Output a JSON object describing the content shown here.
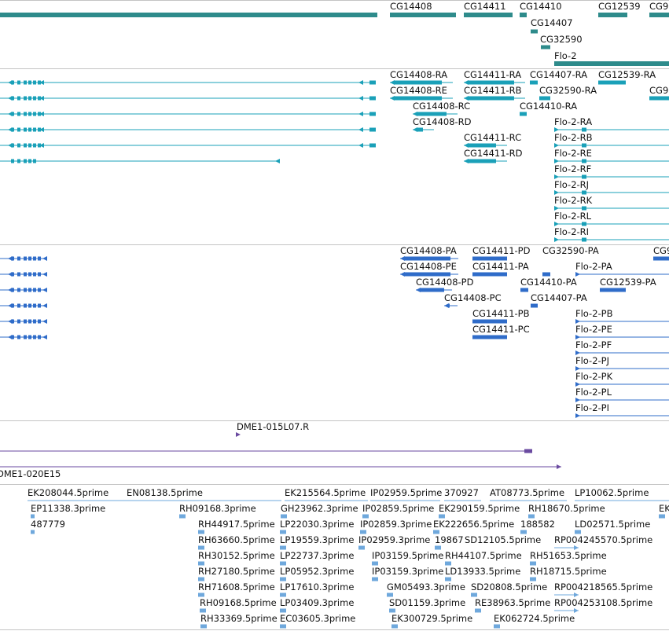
{
  "colors": {
    "gene": "#2e8b8b",
    "transcript": "#1aa0b8",
    "protein": "#2f6cc9",
    "clone": "#6a4aa0",
    "est": "#6fa8dc",
    "separator": "#c4c4c4"
  },
  "tracks": {
    "genes": {
      "labels": [
        "CG14408",
        "CG14411",
        "CG14410",
        "CG12539",
        "CG9",
        "CG14407",
        "CG32590",
        "Flo-2"
      ]
    },
    "transcripts": {
      "labels": [
        "CG14408-RA",
        "CG14411-RA",
        "CG14407-RA",
        "CG12539-RA",
        "CG14408-RE",
        "CG14411-RB",
        "CG32590-RA",
        "CG9",
        "CG14408-RC",
        "CG14410-RA",
        "CG14408-RD",
        "Flo-2-RA",
        "CG14411-RC",
        "Flo-2-RB",
        "CG14411-RD",
        "Flo-2-RE",
        "Flo-2-RF",
        "Flo-2-RJ",
        "Flo-2-RK",
        "Flo-2-RL",
        "Flo-2-RI"
      ]
    },
    "proteins": {
      "labels": [
        "CG14408-PA",
        "CG14411-PD",
        "CG32590-PA",
        "CG9",
        "CG14408-PE",
        "CG14411-PA",
        "Flo-2-PA",
        "CG14408-PD",
        "CG14410-PA",
        "CG12539-PA",
        "CG14408-PC",
        "CG14407-PA",
        "CG14411-PB",
        "Flo-2-PB",
        "CG14411-PC",
        "Flo-2-PE",
        "Flo-2-PF",
        "Flo-2-PJ",
        "Flo-2-PK",
        "Flo-2-PL",
        "Flo-2-PI"
      ]
    },
    "clones": {
      "labels": [
        "DME1-015L07.R",
        "DME1-020E15"
      ]
    },
    "ests": {
      "labels": [
        "EK208044.5prime",
        "EN08138.5prime",
        "EK215564.5prime",
        "IP02959.5prime",
        "370927",
        "AT08773.5prime",
        "LP10062.5prime",
        "EK",
        "EP11338.3prime",
        "RH09168.3prime",
        "GH23962.3prime",
        "IP02859.5prime",
        "EK290159.5prime",
        "RH18670.5prime",
        "487779",
        "RH44917.5prime",
        "LP22030.3prime",
        "IP02859.3prime",
        "EK222656.5prime",
        "188582",
        "LD02571.5prime",
        "RH63660.5prime",
        "LP19559.3prime",
        "IP02959.3prime",
        "19867",
        "SD12105.5prime",
        "RP004245570.5prime",
        "RH30152.5prime",
        "LP22737.3prime",
        "IP03159.5prime",
        "RH44107.5prime",
        "RH51653.5prime",
        "RH27180.5prime",
        "LP05952.3prime",
        "IP03159.3prime",
        "LD13933.5prime",
        "RH18715.5prime",
        "RH71608.5prime",
        "LP17610.3prime",
        "GM05493.3prime",
        "SD20808.5prime",
        "RP004218565.5prime",
        "RH09168.5prime",
        "LP03409.3prime",
        "SD01159.3prime",
        "RE38963.5prime",
        "RP004253108.5prime",
        "RH33369.5prime",
        "EC03605.3prime",
        "EK300729.5prime",
        "EK062724.5prime"
      ]
    }
  }
}
